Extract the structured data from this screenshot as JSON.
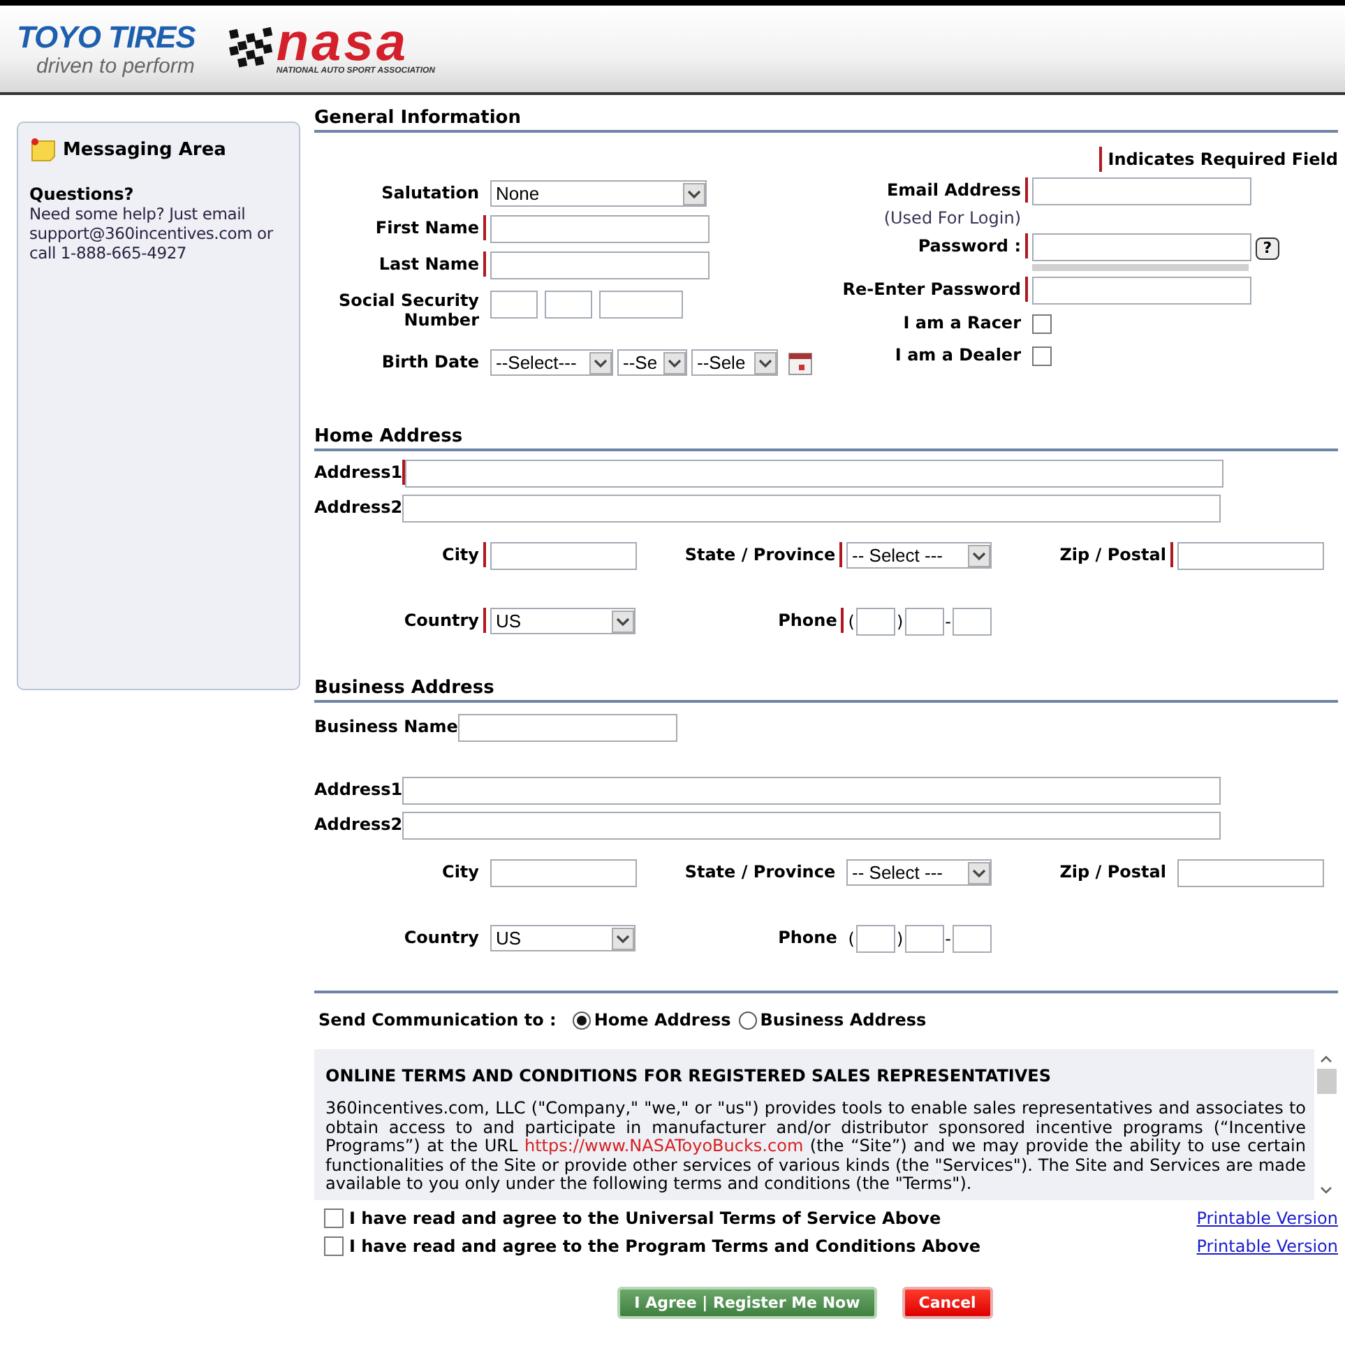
{
  "header": {
    "brand": {
      "name": "TOYO TIRES",
      "tagline": "driven to perform"
    },
    "partner": {
      "name": "nasa",
      "subtitle": "NATIONAL AUTO SPORT ASSOCIATION"
    }
  },
  "sidebar": {
    "title": "Messaging Area",
    "heading": "Questions?",
    "body": "Need some help? Just email support@360incentives.com or call 1-888-665-4927"
  },
  "general": {
    "title": "General Information",
    "required_note": "Indicates Required Field",
    "columns": [
      [
        {
          "label": "Salutation",
          "kind": "select",
          "required": false,
          "value": "None"
        },
        {
          "label": "First Name",
          "kind": "text",
          "required": true
        },
        {
          "label": "Last Name",
          "kind": "text",
          "required": true
        },
        {
          "label": "Social Security Number",
          "kind": "ssn",
          "required": false
        },
        {
          "label": "Birth Date",
          "kind": "date",
          "required": false,
          "values": [
            "--Select---",
            "--Se",
            "--Sele"
          ]
        }
      ],
      [
        {
          "label": "Email Address",
          "kind": "text",
          "required": true,
          "note": "(Used For Login)"
        },
        {
          "label": "Password :",
          "kind": "password",
          "required": true,
          "help": "?"
        },
        {
          "label": "Re-Enter Password",
          "kind": "text",
          "required": true
        },
        {
          "label": "I am a Racer",
          "kind": "checkbox",
          "required": false,
          "checked": false
        },
        {
          "label": "I am a Dealer",
          "kind": "checkbox",
          "required": false,
          "checked": false
        }
      ]
    ]
  },
  "addresses": [
    {
      "title": "Home Address",
      "rows": [
        [
          {
            "label": "Address1",
            "kind": "wide",
            "required": true
          }
        ],
        [
          {
            "label": "Address2",
            "kind": "wide",
            "required": false
          }
        ],
        [
          {
            "label": "City",
            "kind": "short",
            "required": true
          },
          {
            "label": "State / Province",
            "kind": "select",
            "required": true,
            "value": "-- Select ---"
          },
          {
            "label": "Zip / Postal",
            "kind": "short",
            "required": true
          }
        ],
        [
          {
            "label": "Country",
            "kind": "select",
            "required": true,
            "value": "US"
          },
          {
            "label": "Phone",
            "kind": "phone",
            "required": true,
            "marks": [
              "(",
              ")",
              "-"
            ]
          }
        ]
      ]
    },
    {
      "title": "Business Address",
      "rows": [
        [
          {
            "label": "Business Name",
            "kind": "text",
            "required": false
          }
        ],
        [
          {
            "label": "Address1",
            "kind": "wide",
            "required": false
          }
        ],
        [
          {
            "label": "Address2",
            "kind": "wide",
            "required": false
          }
        ],
        [
          {
            "label": "City",
            "kind": "short",
            "required": false
          },
          {
            "label": "State / Province",
            "kind": "select",
            "required": false,
            "value": "-- Select ---"
          },
          {
            "label": "Zip / Postal",
            "kind": "short",
            "required": false
          }
        ],
        [
          {
            "label": "Country",
            "kind": "select",
            "required": false,
            "value": "US"
          },
          {
            "label": "Phone",
            "kind": "phone",
            "required": false,
            "marks": [
              "(",
              ")",
              "-"
            ]
          }
        ]
      ]
    }
  ],
  "communication": {
    "label": "Send Communication to :",
    "options": [
      {
        "label": "Home Address",
        "selected": true
      },
      {
        "label": "Business Address",
        "selected": false
      }
    ]
  },
  "terms": {
    "title": "ONLINE TERMS AND CONDITIONS FOR REGISTERED SALES REPRESENTATIVES",
    "before": "360incentives.com, LLC (\"Company,\" \"we,\" or \"us\") provides tools to enable sales representatives and associates to obtain access to and participate in manufacturer and/or distributor sponsored incentive programs (“Incentive Programs”) at the URL ",
    "link": "https://www.NASAToyoBucks.com",
    "after": " (the “Site”) and we may provide the ability to use certain functionalities of the Site or provide other services of various kinds (the \"Services\"). The Site and Services are made available to you only under the following terms and conditions (the \"Terms\")."
  },
  "agreements": [
    {
      "label": "I have read and agree to the Universal Terms of Service Above",
      "checked": false,
      "link": "Printable Version"
    },
    {
      "label": "I have read and agree to the Program Terms and Conditions Above",
      "checked": false,
      "link": "Printable Version"
    }
  ],
  "buttons": [
    {
      "label": "I Agree | Register Me Now",
      "kind": "primary"
    },
    {
      "label": "Cancel",
      "kind": "cancel"
    }
  ]
}
